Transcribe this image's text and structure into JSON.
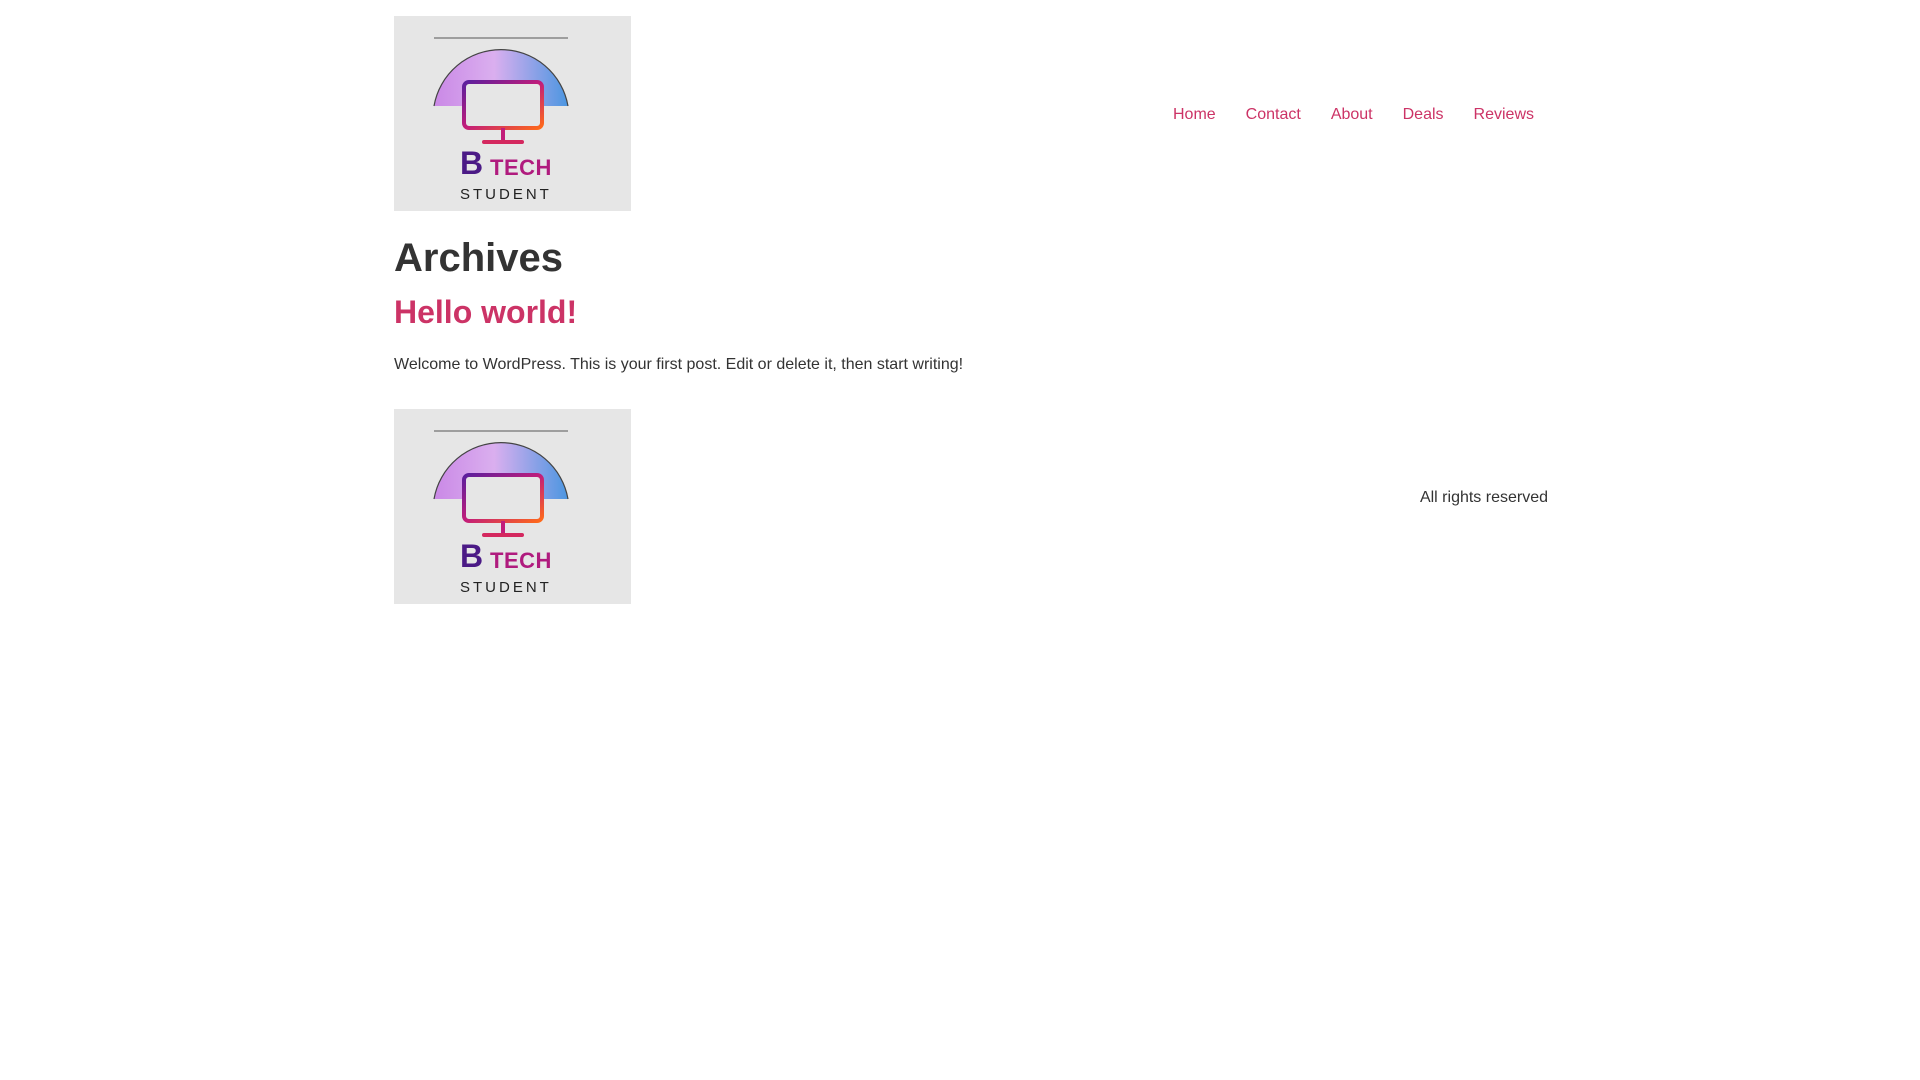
{
  "header": {
    "logo": {
      "letter": "B",
      "word": "TECH",
      "sub": "STUDENT"
    },
    "nav": [
      {
        "label": "Home"
      },
      {
        "label": "Contact"
      },
      {
        "label": "About"
      },
      {
        "label": "Deals"
      },
      {
        "label": "Reviews"
      }
    ]
  },
  "main": {
    "page_title": "Archives",
    "post": {
      "title": "Hello world!",
      "excerpt": "Welcome to WordPress. This is your first post. Edit or delete it, then start writing!"
    }
  },
  "footer": {
    "logo": {
      "letter": "B",
      "word": "TECH",
      "sub": "STUDENT"
    },
    "copyright": "All rights reserved"
  },
  "colors": {
    "link": "#cc3366",
    "text": "#333333",
    "logo_bg": "#e6e6e6",
    "logo_purple": "#4b1a86",
    "logo_magenta": "#b01b7e"
  }
}
